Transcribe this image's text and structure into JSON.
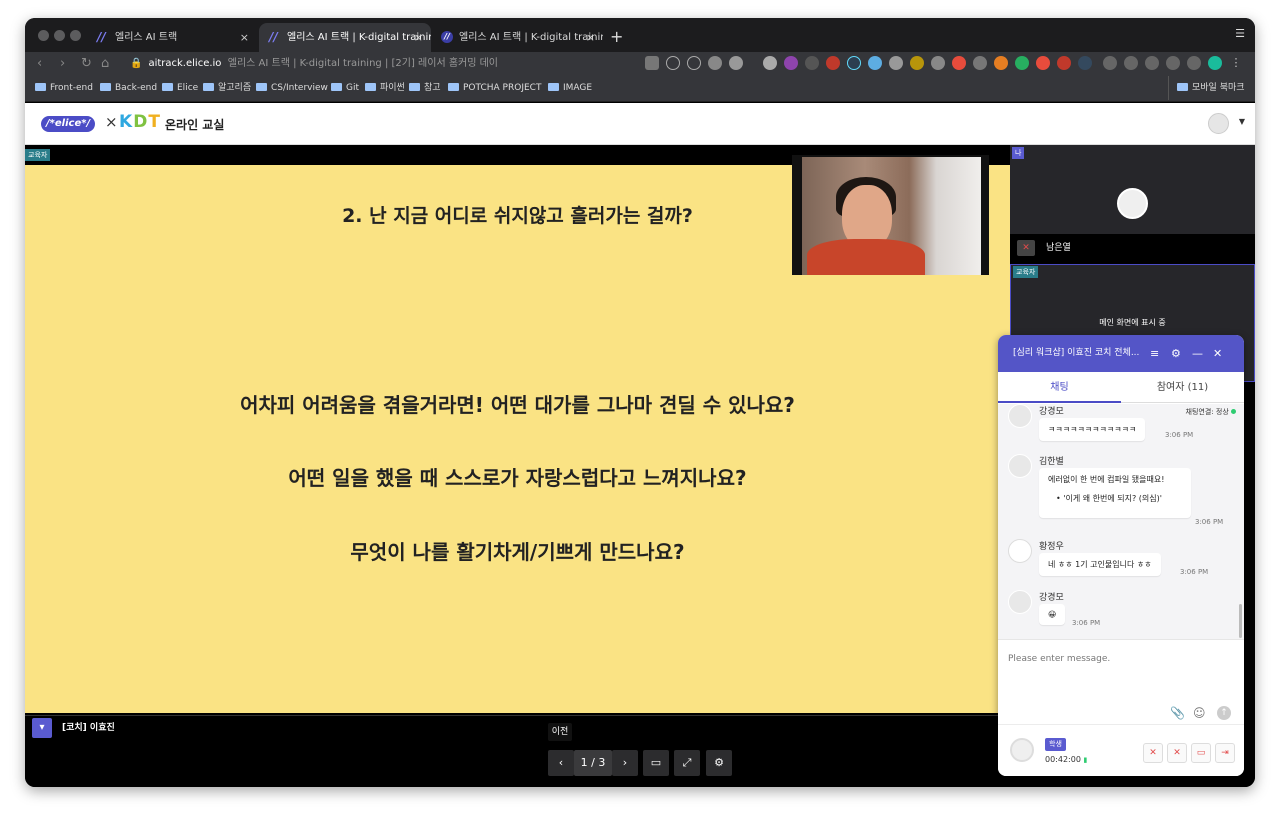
{
  "browser": {
    "tabs": [
      {
        "label": "엘리스 AI 트랙",
        "close": "×"
      },
      {
        "label": "엘리스 AI 트랙 | K-digital training",
        "close": "×"
      },
      {
        "label": "엘리스 AI 트랙 | K-digital training",
        "close": "×"
      }
    ],
    "new_tab": "+",
    "url_host": "aitrack.elice.io",
    "url_title": "엘리스 AI 트랙 | K-digital training | [2기] 레이서 홈커밍 데이",
    "bookmarks": [
      "Front-end",
      "Back-end",
      "Elice",
      "알고리즘",
      "CS/Interview",
      "Git",
      "파이썬",
      "참고",
      "POTCHA PROJECT",
      "IMAGE"
    ],
    "mobile_bookmarks": "모바일 북마크"
  },
  "app": {
    "logo": "/*elice*/",
    "times": "×",
    "kdt": {
      "k": "K",
      "d": "D",
      "t": "T"
    },
    "title": "온라인 교실"
  },
  "slide": {
    "heading": "2. 난 지금 어디로 쉬지않고 흘러가는 걸까?",
    "questions": [
      "어차피 어려움을 겪을거라면! 어떤 대가를 그나마 견딜 수 있나요?",
      "어떤 일을 했을 때 스스로가 자랑스럽다고 느껴지나요?",
      "무엇이 나를 활기차게/기쁘게 만드나요?"
    ],
    "instructor_badge": "교육자",
    "presenter": "[코치] 이효진"
  },
  "controls": {
    "tooltip": "이전",
    "page": "1 / 3"
  },
  "participants": {
    "me_badge": "나",
    "me_name": "남은열",
    "instructor_badge": "교육자",
    "instructor_status": "메인 화면에 표시 중"
  },
  "chat": {
    "title": "[심리 워크샵] 이효진 코치 전체...",
    "tab_chat": "채팅",
    "tab_participants": "참여자 (11)",
    "connection": "채팅연결: 정상",
    "messages": [
      {
        "name": "강경모",
        "text": "ㅋㅋㅋㅋㅋㅋㅋㅋㅋㅋㅋㅋ",
        "time": "3:06 PM"
      },
      {
        "name": "김한별",
        "text": "에러없이 한 번에 컴파일 됐을때요!",
        "bullet": "'이게 왜 한번에 되지? (의심)'",
        "time": "3:06 PM"
      },
      {
        "name": "황정우",
        "text": "네 ㅎㅎ 1기 고인물입니다 ㅎㅎ",
        "time": "3:06 PM"
      },
      {
        "name": "강경모",
        "text": "😀",
        "time": "3:06 PM"
      }
    ],
    "placeholder": "Please enter message.",
    "role": "학생",
    "timer": "00:42:00"
  },
  "colors": {
    "slide_bg": "#fae384",
    "accent": "#5455c7",
    "badge": "#2a7d8a"
  }
}
